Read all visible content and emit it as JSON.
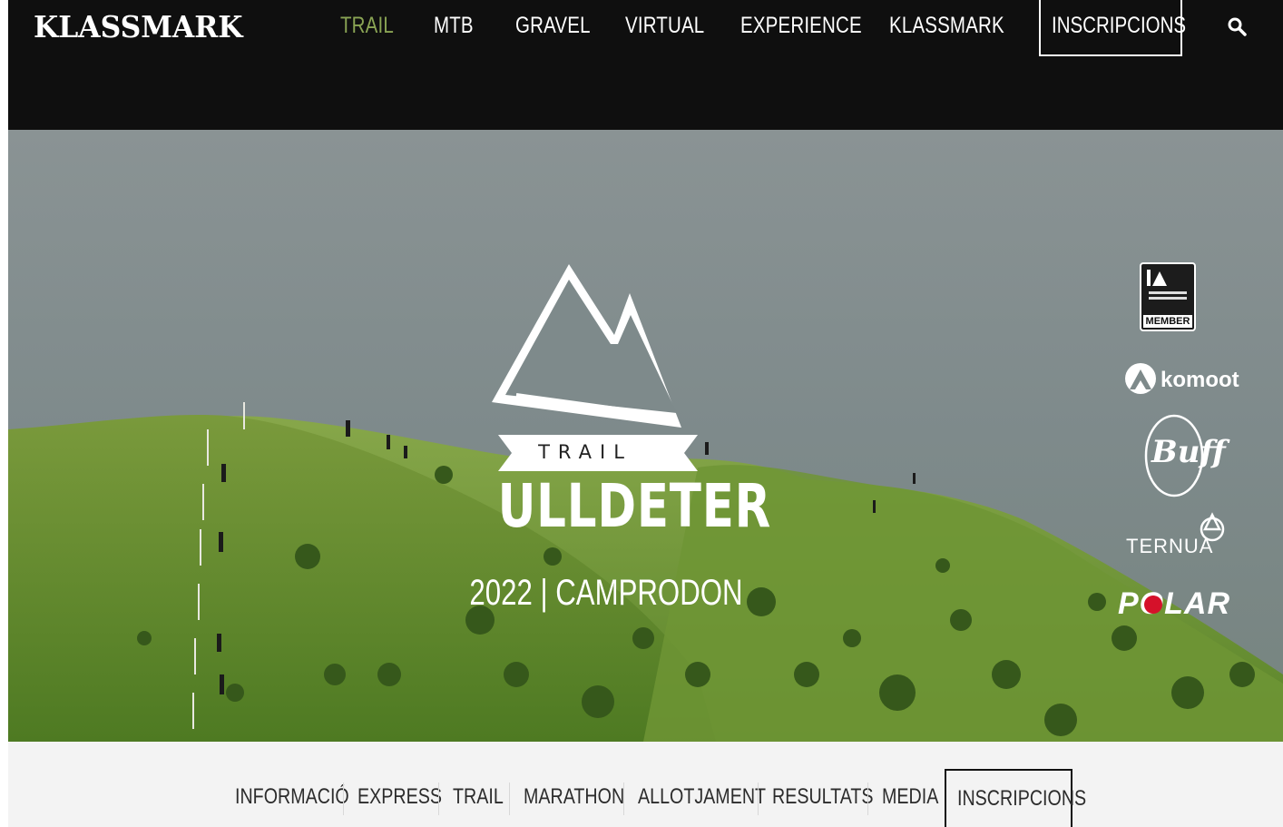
{
  "brand": {
    "name": "KLASSMARK"
  },
  "top_nav": {
    "items": [
      {
        "label": "TRAIL",
        "active": true
      },
      {
        "label": "MTB"
      },
      {
        "label": "GRAVEL"
      },
      {
        "label": "VIRTUAL"
      },
      {
        "label": "EXPERIENCE"
      },
      {
        "label": "KLASSMARK"
      }
    ],
    "cta_label": "INSCRIPCIONS",
    "search_icon": "search-icon",
    "active_color": "#8aa454"
  },
  "hero": {
    "ribbon_text": "TRAIL",
    "event_name": "ULLDETER",
    "subtitle": "2022 | CAMPRODON"
  },
  "sponsors": {
    "itra_label": "MEMBER",
    "komoot": "komoot",
    "buff": "Buff",
    "ternua": "TERNUA",
    "polar": "POLAR"
  },
  "sub_nav": {
    "items": [
      {
        "label": "INFORMACIÓ"
      },
      {
        "label": "EXPRESS"
      },
      {
        "label": "TRAIL"
      },
      {
        "label": "MARATHON"
      },
      {
        "label": "ALLOTJAMENT"
      },
      {
        "label": "RESULTATS"
      },
      {
        "label": "MEDIA"
      }
    ],
    "cta_label": "INSCRIPCIONS"
  }
}
